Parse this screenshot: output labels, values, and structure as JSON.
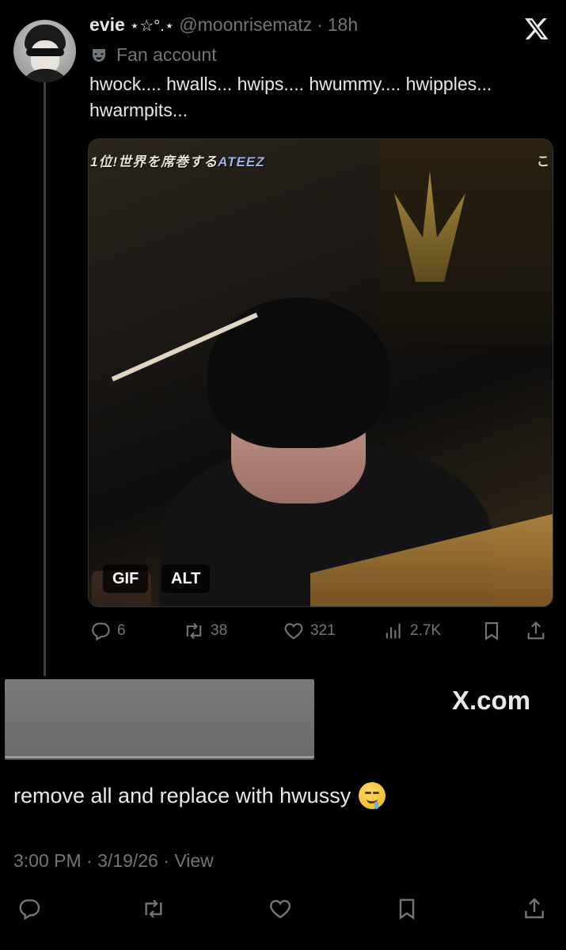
{
  "tweet": {
    "display_name": "evie",
    "name_decoration": "⋆☆°.⋆",
    "handle": "@moonrisematz",
    "separator": "·",
    "time_ago": "18h",
    "label": "Fan account",
    "text": "hwock.... hwalls... hwips.... hwummy.... hwipples... hwarmpits...",
    "media": {
      "banner_text": "1位!世界を席巻する",
      "banner_accent": "ATEEZ",
      "corner_text": "こ",
      "gif_badge": "GIF",
      "alt_badge": "ALT"
    },
    "metrics": {
      "replies": "6",
      "retweets": "38",
      "likes": "321",
      "views": "2.7K"
    }
  },
  "watermark": "X.com",
  "reply": {
    "text": "remove all and replace with hwussy",
    "emoji": "drooling-face"
  },
  "meta": {
    "time": "3:00 PM",
    "date": "3/19/26",
    "view_label": "View",
    "separator": "·"
  },
  "icons": [
    "x-logo-icon",
    "theater-masks-icon",
    "reply-icon",
    "retweet-icon",
    "like-icon",
    "views-icon",
    "bookmark-icon",
    "share-icon"
  ]
}
